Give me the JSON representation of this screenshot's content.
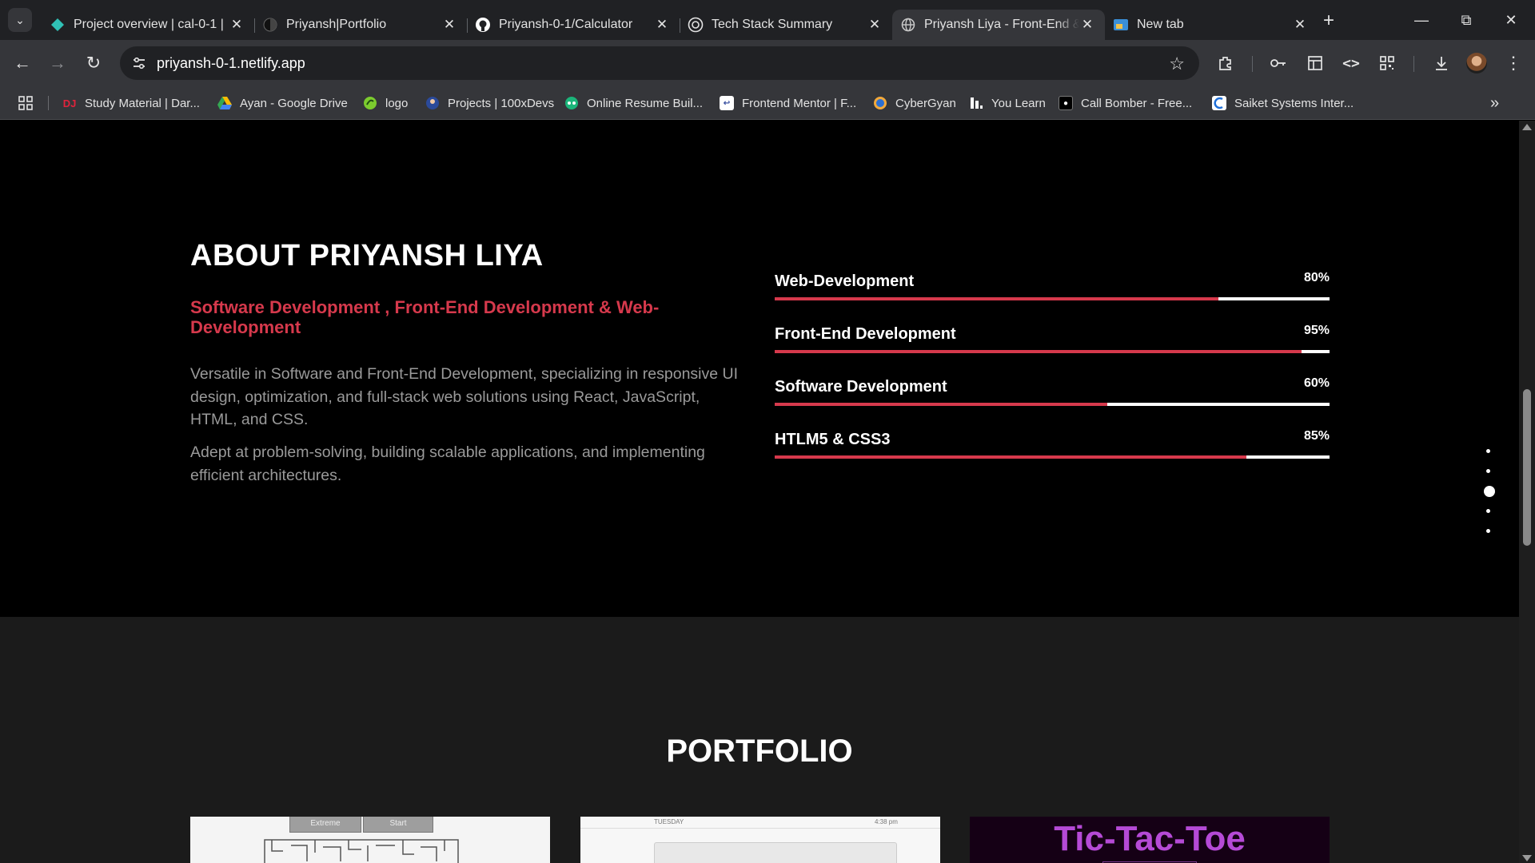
{
  "browser": {
    "tabs": [
      {
        "title": "Project overview | cal-0-1 |",
        "icon": "netlify-icon",
        "active": false
      },
      {
        "title": "Priyansh|Portfolio",
        "icon": "portfolio-icon",
        "active": false
      },
      {
        "title": "Priyansh-0-1/Calculator",
        "icon": "github-icon",
        "active": false
      },
      {
        "title": "Tech Stack Summary",
        "icon": "openai-icon",
        "active": false
      },
      {
        "title": "Priyansh Liya - Front-End & ",
        "icon": "globe-icon",
        "active": true
      },
      {
        "title": "New tab",
        "icon": "new-tab-icon",
        "active": false
      }
    ],
    "url": "priyansh-0-1.netlify.app",
    "bookmarks": [
      {
        "label": "Study Material | Dar...",
        "icon": "dar-icon"
      },
      {
        "label": "Ayan - Google Drive",
        "icon": "google-drive-icon"
      },
      {
        "label": "logo",
        "icon": "logo-icon"
      },
      {
        "label": "Projects | 100xDevs",
        "icon": "100xdevs-icon"
      },
      {
        "label": "Online Resume Buil...",
        "icon": "resume-icon"
      },
      {
        "label": "Frontend Mentor | F...",
        "icon": "frontend-mentor-icon"
      },
      {
        "label": "CyberGyan",
        "icon": "cybergyan-icon"
      },
      {
        "label": "You Learn",
        "icon": "you-learn-icon"
      },
      {
        "label": "Call Bomber - Free...",
        "icon": "call-bomber-icon"
      },
      {
        "label": "Saiket Systems Inter...",
        "icon": "saiket-icon"
      }
    ]
  },
  "about": {
    "title": "ABOUT PRIYANSH LIYA",
    "subtitle": "Software Development , Front-End Development & Web-Development",
    "paragraphs": [
      "Versatile in Software and Front-End Development, specializing in responsive UI design, optimization, and full-stack web solutions using React, JavaScript, HTML, and CSS.",
      "Adept at problem-solving, building scalable applications, and implementing efficient architectures."
    ]
  },
  "skills": [
    {
      "name": "Web-Development",
      "percent_label": "80%",
      "level": 0.8
    },
    {
      "name": "Front-End Development",
      "percent_label": "95%",
      "level": 0.95
    },
    {
      "name": "Software Development",
      "percent_label": "60%",
      "level": 0.6
    },
    {
      "name": "HTLM5 & CSS3",
      "percent_label": "85%",
      "level": 0.85
    }
  ],
  "section_nav": {
    "count": 5,
    "active_index": 2
  },
  "portfolio": {
    "title": "PORTFOLIO",
    "cards": [
      {
        "thumb_buttons": [
          "Extreme",
          "Start"
        ]
      },
      {
        "thumb_header_left": "TUESDAY",
        "thumb_header_right": "4:38 pm"
      },
      {
        "thumb_title": "Tic-Tac-Toe"
      }
    ]
  },
  "colors": {
    "accent": "#d6394c",
    "page_bg": "#000000",
    "portfolio_bg": "#1b1b1b",
    "text_muted": "#9a9a9a",
    "tictactoe_text": "#b54ad6",
    "tictactoe_bg": "#150015"
  }
}
